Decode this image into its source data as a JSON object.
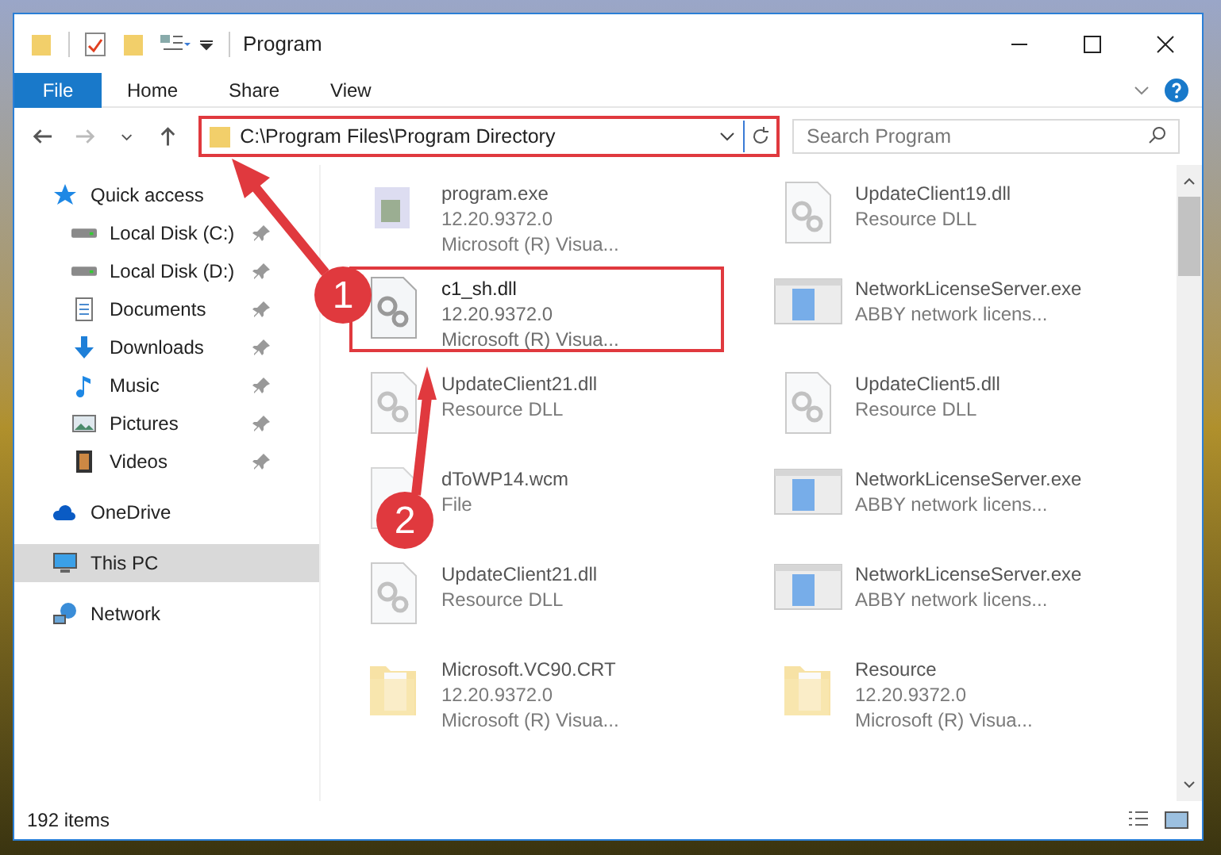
{
  "window": {
    "title": "Program"
  },
  "ribbon_tabs": [
    {
      "label": "File",
      "selected": true
    },
    {
      "label": "Home",
      "selected": false
    },
    {
      "label": "Share",
      "selected": false
    },
    {
      "label": "View",
      "selected": false
    }
  ],
  "address_bar": {
    "path": "C:\\Program Files\\Program Directory",
    "highlighted": true
  },
  "search": {
    "placeholder": "Search Program"
  },
  "navigation": [
    {
      "label": "Quick access",
      "kind": "quick",
      "selected": false,
      "children": [
        {
          "label": "Local Disk (C:)",
          "kind": "disk",
          "selected": false,
          "pinned": true
        },
        {
          "label": "Local Disk (D:)",
          "kind": "disk",
          "selected": false,
          "pinned": true
        },
        {
          "label": "Documents",
          "kind": "documents",
          "selected": false,
          "pinned": true
        },
        {
          "label": "Downloads",
          "kind": "downloads",
          "selected": false,
          "pinned": true
        },
        {
          "label": "Music",
          "kind": "music",
          "selected": false,
          "pinned": true
        },
        {
          "label": "Pictures",
          "kind": "pictures",
          "selected": false,
          "pinned": true
        },
        {
          "label": "Videos",
          "kind": "videos",
          "selected": false,
          "pinned": true
        }
      ]
    },
    {
      "label": "OneDrive",
      "kind": "cloud",
      "selected": false
    },
    {
      "label": "This PC",
      "kind": "pc",
      "selected": true
    },
    {
      "label": "Network",
      "kind": "network",
      "selected": false
    }
  ],
  "files": [
    {
      "name": "program.exe",
      "lines": [
        "12.20.9372.0",
        "Microsoft (R) Visua..."
      ],
      "kind": "exe",
      "highlighted": false
    },
    {
      "name": "UpdateClient19.dll",
      "lines": [
        "Resource DLL"
      ],
      "kind": "dll",
      "highlighted": false
    },
    {
      "name": "c1_sh.dll",
      "lines": [
        "12.20.9372.0",
        "Microsoft (R) Visua..."
      ],
      "kind": "dll",
      "highlighted": true
    },
    {
      "name": "NetworkLicenseServer.exe",
      "lines": [
        "ABBY network licens..."
      ],
      "kind": "app",
      "highlighted": false
    },
    {
      "name": "UpdateClient21.dll",
      "lines": [
        "Resource DLL"
      ],
      "kind": "dll",
      "highlighted": false
    },
    {
      "name": "UpdateClient5.dll",
      "lines": [
        "Resource DLL"
      ],
      "kind": "dll",
      "highlighted": false
    },
    {
      "name": "dToWP14.wcm",
      "lines": [
        "File"
      ],
      "kind": "blank",
      "highlighted": false
    },
    {
      "name": "NetworkLicenseServer.exe",
      "lines": [
        "ABBY network licens..."
      ],
      "kind": "app",
      "highlighted": false
    },
    {
      "name": "UpdateClient21.dll",
      "lines": [
        "Resource DLL"
      ],
      "kind": "dll",
      "highlighted": false
    },
    {
      "name": "NetworkLicenseServer.exe",
      "lines": [
        "ABBY network licens..."
      ],
      "kind": "app",
      "highlighted": false
    },
    {
      "name": "Microsoft.VC90.CRT",
      "lines": [
        "12.20.9372.0",
        "Microsoft (R) Visua..."
      ],
      "kind": "folder",
      "highlighted": false
    },
    {
      "name": "Resource",
      "lines": [
        "12.20.9372.0",
        "Microsoft (R) Visua..."
      ],
      "kind": "folder",
      "highlighted": false
    }
  ],
  "status_bar": {
    "item_count": "192 items"
  },
  "annotations": [
    {
      "label": "1"
    },
    {
      "label": "2"
    }
  ]
}
